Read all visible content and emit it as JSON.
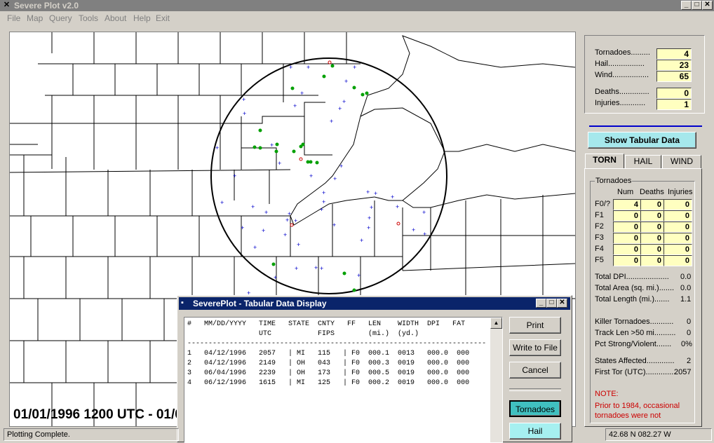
{
  "window": {
    "title": "Severe Plot v2.0"
  },
  "menu": [
    "File",
    "Map",
    "Query",
    "Tools",
    "About",
    "Help",
    "Exit"
  ],
  "map": {
    "timestamp": "01/01/1996 1200 UTC - 01/0"
  },
  "summary": {
    "tornadoes_label": "Tornadoes.........",
    "tornadoes": "4",
    "hail_label": "Hail.................",
    "hail": "23",
    "wind_label": "Wind.................",
    "wind": "65",
    "deaths_label": "Deaths..............",
    "deaths": "0",
    "injuries_label": "Injuries............",
    "injuries": "1"
  },
  "show_tabular_button": "Show Tabular Data",
  "tabs": [
    "TORN",
    "HAIL",
    "WIND"
  ],
  "torn_panel": {
    "group_label": "Tornadoes",
    "col_headers": [
      "Num",
      "Deaths",
      "Injuries"
    ],
    "rows": [
      {
        "label": "F0/?",
        "num": "4",
        "deaths": "0",
        "injuries": "0"
      },
      {
        "label": "F1",
        "num": "0",
        "deaths": "0",
        "injuries": "0"
      },
      {
        "label": "F2",
        "num": "0",
        "deaths": "0",
        "injuries": "0"
      },
      {
        "label": "F3",
        "num": "0",
        "deaths": "0",
        "injuries": "0"
      },
      {
        "label": "F4",
        "num": "0",
        "deaths": "0",
        "injuries": "0"
      },
      {
        "label": "F5",
        "num": "0",
        "deaths": "0",
        "injuries": "0"
      }
    ],
    "stats": [
      {
        "label": "Total DPI....................",
        "value": "0.0"
      },
      {
        "label": "Total Area (sq. mi.).......",
        "value": "0.0"
      },
      {
        "label": "Total Length (mi.).......",
        "value": "1.1"
      },
      {
        "label": "Killer Tornadoes...........",
        "value": "0"
      },
      {
        "label": "Track Len >50 mi..........",
        "value": "0"
      },
      {
        "label": "Pct Strong/Violent.......",
        "value": "0%"
      },
      {
        "label": "States Affected.............",
        "value": "2"
      },
      {
        "label": "First Tor (UTC)..............",
        "value": "2057"
      }
    ],
    "note_title": "NOTE:",
    "note_text": "Prior to 1984, occasional tornadoes were not"
  },
  "dialog": {
    "title": "SeverePlot - Tabular Data Display",
    "header1": "#   MM/DD/YYYY   TIME   STATE  CNTY   FF   LEN    WIDTH  DPI   FAT",
    "header2": "                 UTC           FIPS        (mi.)  (yd.)",
    "separator": "-----------------------------------------------------------------------",
    "rows": [
      "1   04/12/1996   2057   | MI   115   | F0  000.1  0013   000.0  000",
      "2   04/12/1996   2149   | OH   043   | F0  000.3  0019   000.0  000",
      "3   06/04/1996   2239   | OH   173   | F0  000.5  0019   000.0  000",
      "4   06/12/1996   1615   | MI   125   | F0  000.2  0019   000.0  000"
    ],
    "buttons": {
      "print": "Print",
      "write": "Write to File",
      "cancel": "Cancel",
      "tornadoes": "Tornadoes",
      "hail": "Hail"
    }
  },
  "status": {
    "left": "Plotting Complete.",
    "coords": "42.68 N  082.27 W"
  },
  "colors": {
    "blue_report": "#0000cc",
    "green_report": "#00aa00",
    "tornado_red": "#cc0000",
    "yellow_field": "#ffffc0",
    "teal_button": "#40c0c0"
  }
}
